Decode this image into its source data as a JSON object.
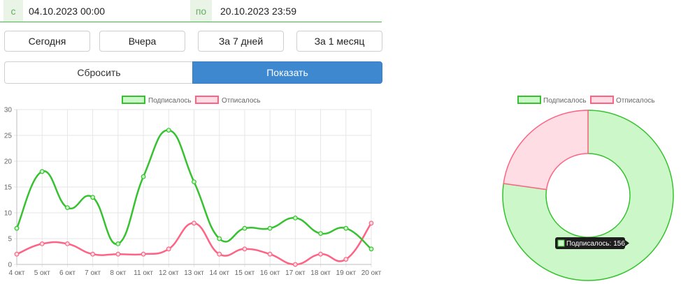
{
  "filters": {
    "from_prefix": "с",
    "from_value": "04.10.2023 00:00",
    "to_prefix": "по",
    "to_value": "20.10.2023 23:59"
  },
  "quick_buttons": {
    "today": "Сегодня",
    "yesterday": "Вчера",
    "last7": "За 7 дней",
    "last_month": "За 1 месяц"
  },
  "actions": {
    "reset": "Сбросить",
    "show": "Показать"
  },
  "colors": {
    "subscribed": "#36c22f",
    "subscribed_fill": "#ccf8c9",
    "unsubscribed": "#ff6384",
    "unsubscribed_fill": "#ffdde4",
    "accent": "#3e88cf"
  },
  "chart_data": [
    {
      "type": "line",
      "x": [
        "4 окт",
        "5 окт",
        "6 окт",
        "7 окт",
        "8 окт",
        "11 окт",
        "12 окт",
        "13 окт",
        "14 окт",
        "15 окт",
        "16 окт",
        "17 окт",
        "18 окт",
        "19 окт",
        "20 окт"
      ],
      "series": [
        {
          "name": "Подписалось",
          "values": [
            7,
            18,
            11,
            13,
            4,
            17,
            26,
            16,
            5,
            7,
            7,
            9,
            6,
            7,
            3
          ]
        },
        {
          "name": "Отписалось",
          "values": [
            2,
            4,
            4,
            2,
            2,
            2,
            3,
            8,
            2,
            3,
            2,
            0,
            2,
            1,
            8
          ]
        }
      ],
      "ylim": [
        0,
        30
      ],
      "yticks": [
        "0",
        "5",
        "10",
        "15",
        "20",
        "25",
        "30"
      ],
      "legend_position": "top",
      "grid": true
    },
    {
      "type": "pie",
      "donut": true,
      "categories": [
        "Подписалось",
        "Отписалось"
      ],
      "values": [
        156,
        46
      ],
      "legend_position": "top",
      "tooltip": "Подписалось: 156"
    }
  ]
}
